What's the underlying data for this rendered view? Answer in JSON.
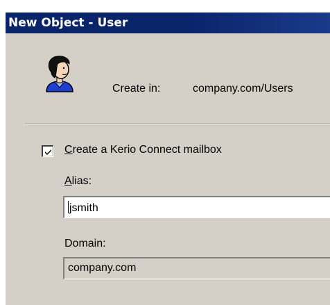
{
  "window": {
    "title": "New Object - User"
  },
  "header": {
    "icon": "user-icon",
    "create_in_label": "Create in:",
    "create_in_value": "company.com/Users"
  },
  "mailbox": {
    "checkbox_checked": true,
    "checkbox_label_prefix": "C",
    "checkbox_label_rest": "reate a Kerio Connect mailbox",
    "alias_label_prefix": "A",
    "alias_label_rest": "lias:",
    "alias_value": "jsmith",
    "domain_label": "Domain:",
    "domain_value": "company.com"
  },
  "colors": {
    "titlebar": "#0a246a",
    "dialog_face": "#d4d0c8",
    "title_text": "#ffffff"
  }
}
